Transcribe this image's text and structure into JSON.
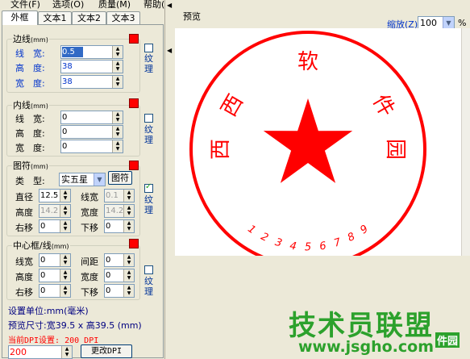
{
  "menu": {
    "file": "文件(F)",
    "options": "选项(O)",
    "quality": "质量(M)",
    "help": "帮助(H)"
  },
  "tabs": [
    "外框",
    "文本1",
    "文本2",
    "文本3"
  ],
  "outer_line": {
    "title": "边线",
    "unit": "(mm)",
    "width_label": "线　宽:",
    "width": "0.5",
    "height_label": "高　度:",
    "height": "38",
    "breadth_label": "宽　度:",
    "breadth": "38",
    "texture_label": "纹理",
    "texture_checked": false,
    "color": "#ff0000"
  },
  "inner_line": {
    "title": "内线",
    "unit": "(mm)",
    "width_label": "线　宽:",
    "width": "0",
    "height_label": "高　度:",
    "height": "0",
    "breadth_label": "宽　度:",
    "breadth": "0",
    "texture_label": "纹理",
    "texture_checked": false,
    "color": "#ff0000"
  },
  "symbol": {
    "title": "图符",
    "unit": "(mm)",
    "type_label": "类　型:",
    "type_value": "实五星",
    "symbol_button": "图符",
    "diameter_label": "直径",
    "diameter": "12.5",
    "linewidth_label": "线宽",
    "linewidth": "0.1",
    "height_label": "高度",
    "height": "14.2",
    "width_label": "宽度",
    "width": "14.2",
    "right_label": "右移",
    "right": "0",
    "down_label": "下移",
    "down": "0",
    "texture_label": "纹理",
    "texture_checked": true,
    "color": "#ff0000"
  },
  "center": {
    "title": "中心框/线",
    "unit": "(mm)",
    "linewidth_label": "线宽",
    "linewidth": "0",
    "spacing_label": "间距",
    "spacing": "0",
    "height_label": "高度",
    "height": "0",
    "width_label": "宽度",
    "width": "0",
    "right_label": "右移",
    "right": "0",
    "down_label": "下移",
    "down": "0",
    "texture_label": "纹理",
    "texture_checked": false,
    "color": "#ff0000"
  },
  "footer": {
    "unit_setting": "设置单位:mm(毫米)",
    "preview_size": "预览尺寸:宽39.5 x 高39.5 (mm)",
    "dpi_setting": "当前DPI设置: 200 DPI",
    "dpi_value": "200",
    "change_dpi_button": "更改DPI"
  },
  "preview": {
    "title": "预览",
    "zoom_label": "缩放(Z)",
    "zoom_value": "100",
    "zoom_unit": "%",
    "stamp_chars": [
      "西",
      "西",
      "软",
      "件",
      "园"
    ],
    "stamp_digits": [
      "1",
      "2",
      "3",
      "4",
      "5",
      "6",
      "7",
      "8",
      "9"
    ],
    "stamp_color": "#ff0000"
  },
  "watermark": {
    "main": "技术员联盟",
    "url": "www.jsgho.com",
    "sub": "件园"
  }
}
